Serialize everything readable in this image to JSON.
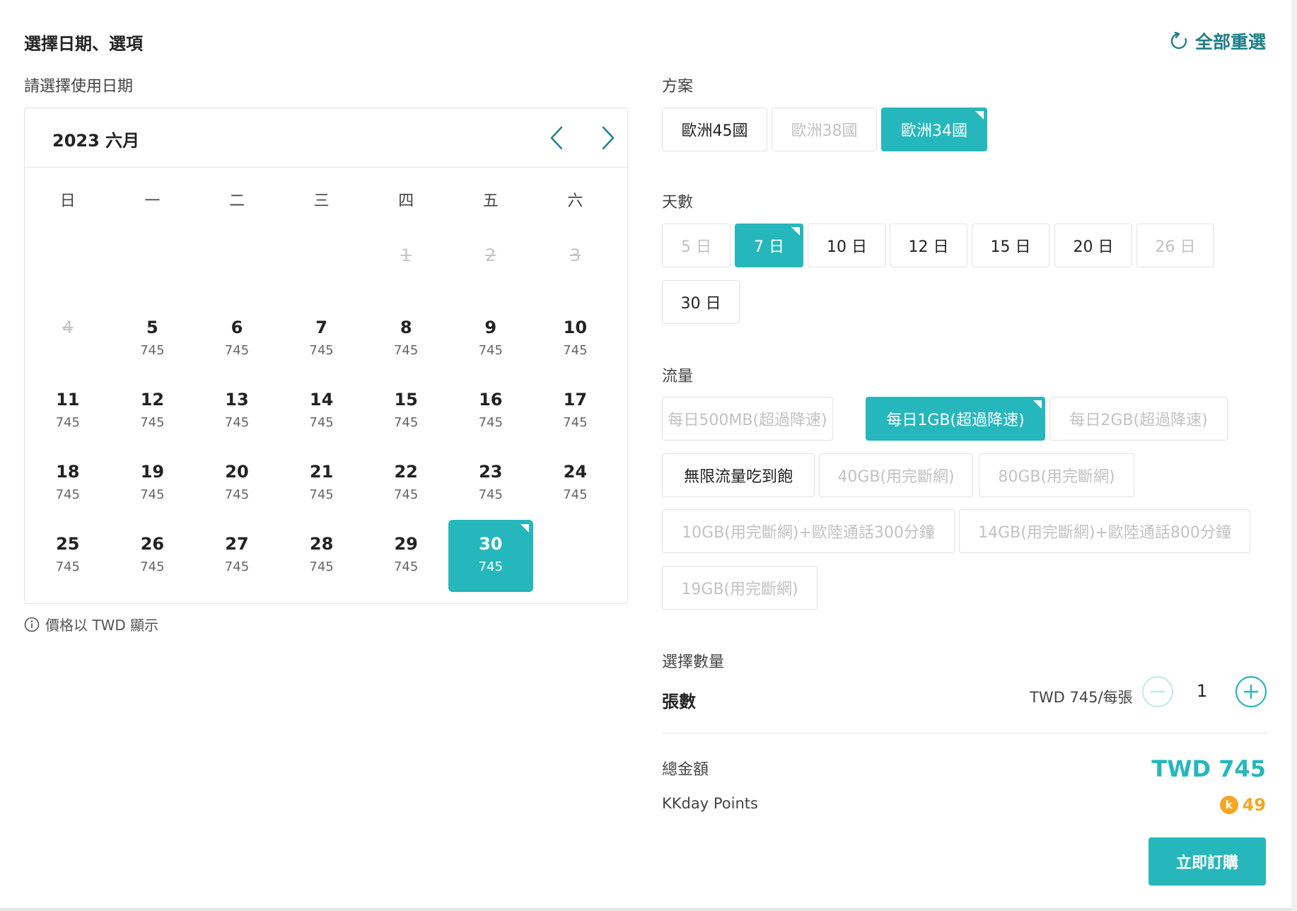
{
  "header": {
    "title": "選擇日期、選項",
    "reset_label": "全部重選"
  },
  "calendar": {
    "label": "請選擇使用日期",
    "month_title": "2023 六月",
    "weekdays": [
      "日",
      "一",
      "二",
      "三",
      "四",
      "五",
      "六"
    ],
    "weeks": [
      [
        null,
        null,
        null,
        null,
        {
          "day": "1",
          "disabled": true
        },
        {
          "day": "2",
          "disabled": true
        },
        {
          "day": "3",
          "disabled": true
        }
      ],
      [
        {
          "day": "4",
          "disabled": true
        },
        {
          "day": "5",
          "price": "745"
        },
        {
          "day": "6",
          "price": "745"
        },
        {
          "day": "7",
          "price": "745"
        },
        {
          "day": "8",
          "price": "745"
        },
        {
          "day": "9",
          "price": "745"
        },
        {
          "day": "10",
          "price": "745"
        }
      ],
      [
        {
          "day": "11",
          "price": "745"
        },
        {
          "day": "12",
          "price": "745"
        },
        {
          "day": "13",
          "price": "745"
        },
        {
          "day": "14",
          "price": "745"
        },
        {
          "day": "15",
          "price": "745"
        },
        {
          "day": "16",
          "price": "745"
        },
        {
          "day": "17",
          "price": "745"
        }
      ],
      [
        {
          "day": "18",
          "price": "745"
        },
        {
          "day": "19",
          "price": "745"
        },
        {
          "day": "20",
          "price": "745"
        },
        {
          "day": "21",
          "price": "745"
        },
        {
          "day": "22",
          "price": "745"
        },
        {
          "day": "23",
          "price": "745"
        },
        {
          "day": "24",
          "price": "745"
        }
      ],
      [
        {
          "day": "25",
          "price": "745"
        },
        {
          "day": "26",
          "price": "745"
        },
        {
          "day": "27",
          "price": "745"
        },
        {
          "day": "28",
          "price": "745"
        },
        {
          "day": "29",
          "price": "745"
        },
        {
          "day": "30",
          "price": "745",
          "selected": true
        },
        null
      ]
    ],
    "currency_note": "價格以 TWD 顯示"
  },
  "options": {
    "plan": {
      "label": "方案",
      "items": [
        {
          "text": "歐洲45國",
          "state": "normal"
        },
        {
          "text": "歐洲38國",
          "state": "disabled"
        },
        {
          "text": "歐洲34國",
          "state": "selected"
        }
      ]
    },
    "days": {
      "label": "天數",
      "items": [
        {
          "text": "5 日",
          "state": "disabled"
        },
        {
          "text": "7 日",
          "state": "selected"
        },
        {
          "text": "10 日",
          "state": "normal"
        },
        {
          "text": "12 日",
          "state": "normal"
        },
        {
          "text": "15 日",
          "state": "normal"
        },
        {
          "text": "20 日",
          "state": "normal"
        },
        {
          "text": "26 日",
          "state": "disabled"
        },
        {
          "text": "30 日",
          "state": "normal"
        }
      ]
    },
    "data": {
      "label": "流量",
      "items": [
        {
          "text": "每日500MB(超過降速)",
          "state": "disabled"
        },
        {
          "text": "每日1GB(超過降速)",
          "state": "selected"
        },
        {
          "text": "每日2GB(超過降速)",
          "state": "disabled"
        },
        {
          "text": "無限流量吃到飽",
          "state": "normal"
        },
        {
          "text": "40GB(用完斷網)",
          "state": "disabled"
        },
        {
          "text": "80GB(用完斷網)",
          "state": "disabled"
        },
        {
          "text": "10GB(用完斷網)+歐陸通話300分鐘",
          "state": "disabled"
        },
        {
          "text": "14GB(用完斷網)+歐陸通話800分鐘",
          "state": "disabled"
        },
        {
          "text": "19GB(用完斷網)",
          "state": "disabled"
        }
      ]
    }
  },
  "quantity": {
    "section_label": "選擇數量",
    "item_label": "張數",
    "unit_price": "TWD 745/每張",
    "value": "1"
  },
  "summary": {
    "total_label": "總金額",
    "total_value": "TWD 745",
    "points_label": "KKday Points",
    "points_value": "49",
    "coin_glyph": "k"
  },
  "actions": {
    "buy_label": "立即訂購"
  },
  "colors": {
    "accent": "#26b7bc",
    "reset": "#1e7f88",
    "points": "#f5a623"
  }
}
